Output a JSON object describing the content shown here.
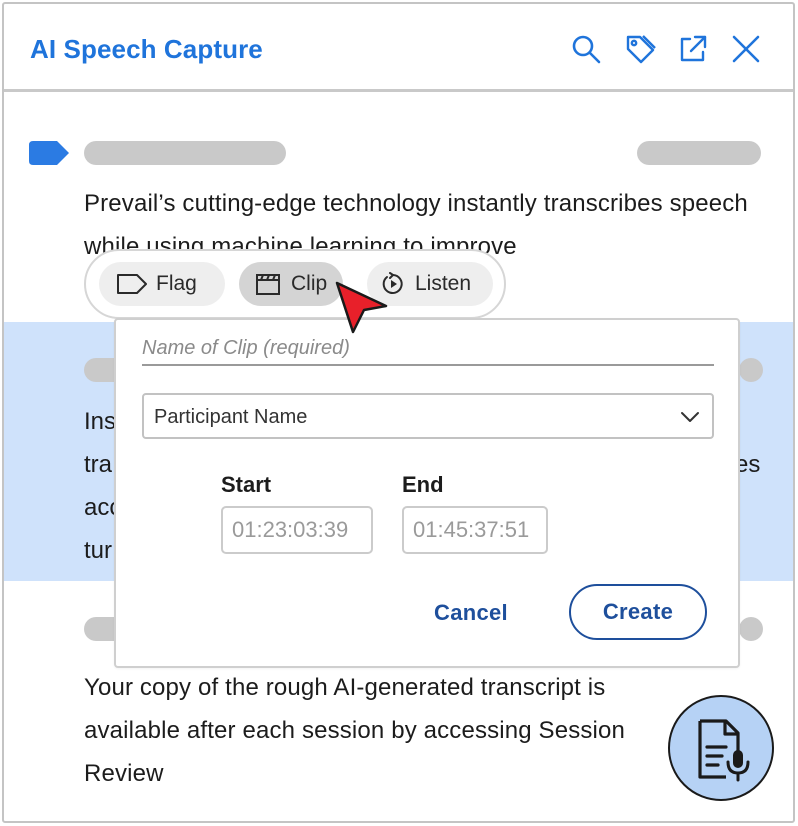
{
  "app": {
    "title": "AI Speech Capture"
  },
  "header_icons": [
    "search-icon",
    "tag-icon",
    "external-link-icon",
    "close-icon"
  ],
  "transcript": {
    "paragraph_1": "Prevail’s cutting-edge technology instantly transcribes speech while using machine learning to improve",
    "paragraph_2_left_fragments": [
      "Ins",
      "tra",
      "acc",
      "tur"
    ],
    "paragraph_2_right_fragment": "es",
    "paragraph_3": "Your copy of the rough AI-generated transcript is available after each session by accessing Session Review"
  },
  "toolbar": {
    "flag_label": "Flag",
    "clip_label": "Clip",
    "listen_label": "Listen",
    "active": "clip"
  },
  "clip_form": {
    "name_placeholder": "Name of Clip (required)",
    "name_value": "",
    "participant_selected": "Participant Name",
    "start_label": "Start",
    "end_label": "End",
    "start_value": "01:23:03:39",
    "end_value": "01:45:37:51",
    "cancel_label": "Cancel",
    "create_label": "Create"
  },
  "colors": {
    "brand_blue": "#1f74db",
    "action_blue": "#1e4f9c",
    "highlight": "#cfe2fb",
    "placeholder_gray": "#c9c9c9",
    "cursor_red": "#e8202a",
    "fab_fill": "#b6d2f5"
  }
}
